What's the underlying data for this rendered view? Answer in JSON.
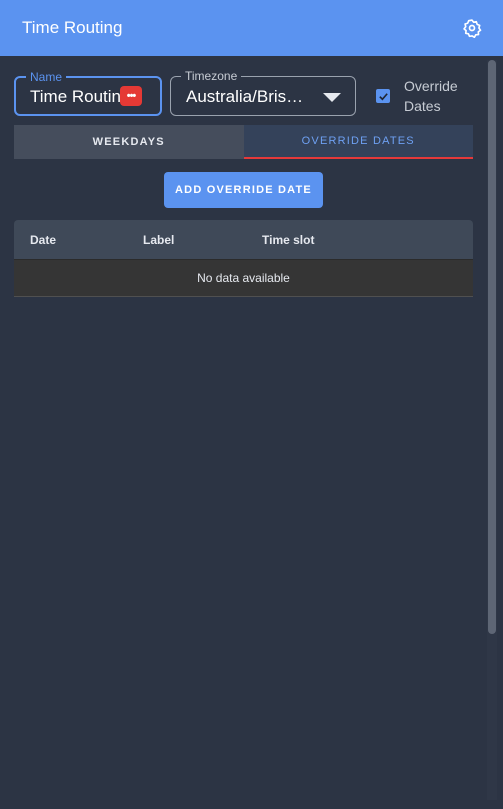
{
  "header": {
    "title": "Time Routing",
    "settings_icon": "gear-icon"
  },
  "form": {
    "name": {
      "label": "Name",
      "value": "Time Routing",
      "badge_icon": "password-manager-icon",
      "badge_text": "•••"
    },
    "timezone": {
      "label": "Timezone",
      "value": "Australia/Brisbane",
      "dropdown_icon": "caret-down-icon"
    },
    "override_dates": {
      "label": "Override Dates",
      "checked": true
    }
  },
  "tabs": [
    {
      "label": "WEEKDAYS",
      "active": false
    },
    {
      "label": "OVERRIDE DATES",
      "active": true
    }
  ],
  "add_button": {
    "label": "ADD OVERRIDE DATE"
  },
  "table": {
    "columns": [
      "Date",
      "Label",
      "Time slot"
    ],
    "empty_text": "No data available"
  },
  "colors": {
    "accent": "#5b93f0",
    "background": "#2c3444",
    "tab_indicator": "#e5393a"
  }
}
